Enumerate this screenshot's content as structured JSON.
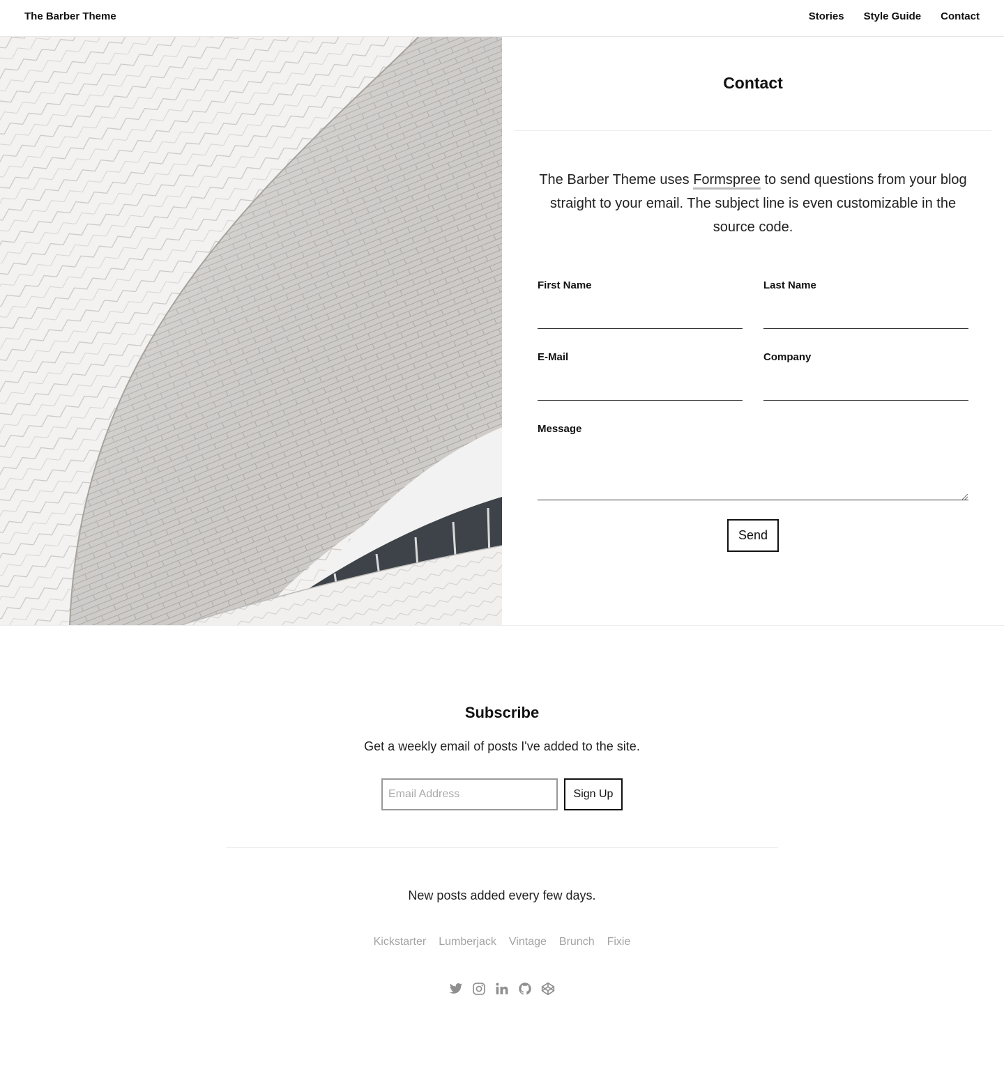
{
  "header": {
    "brand": "The Barber Theme",
    "nav": [
      "Stories",
      "Style Guide",
      "Contact"
    ]
  },
  "contact": {
    "title": "Contact",
    "intro_before": "The Barber Theme uses ",
    "intro_link": "Formspree",
    "intro_after": " to send questions from your blog straight to your email. The subject line is even customizable in the source code.",
    "fields": {
      "first_name": "First Name",
      "last_name": "Last Name",
      "email": "E-Mail",
      "company": "Company",
      "message": "Message"
    },
    "send_label": "Send"
  },
  "subscribe": {
    "title": "Subscribe",
    "text": "Get a weekly email of posts I've added to the site.",
    "email_placeholder": "Email Address",
    "button_label": "Sign Up"
  },
  "footer": {
    "note": "New posts added every few days.",
    "tags": [
      "Kickstarter",
      "Lumberjack",
      "Vintage",
      "Brunch",
      "Fixie"
    ],
    "social_icons": [
      "twitter-icon",
      "instagram-icon",
      "linkedin-icon",
      "github-icon",
      "codepen-icon"
    ]
  },
  "colors": {
    "text": "#222222",
    "muted": "#a3a3a3",
    "rule": "#ececec",
    "link_underline": "#bbbbbb"
  }
}
